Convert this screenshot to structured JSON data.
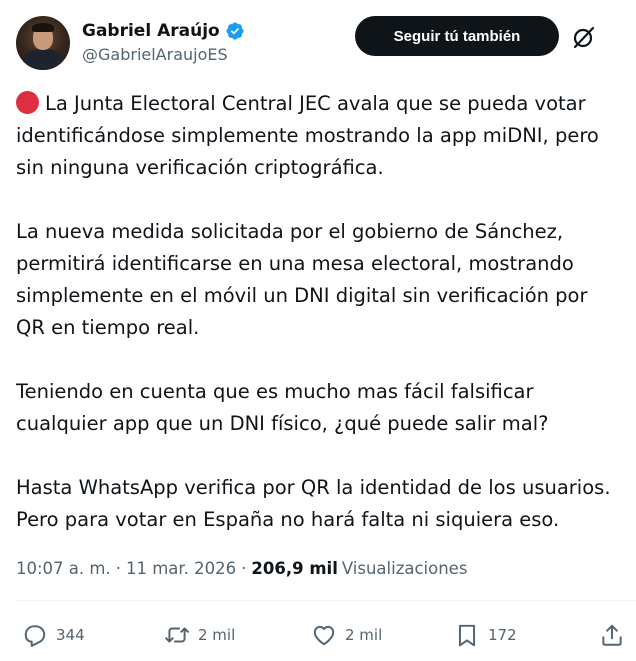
{
  "author": {
    "display_name": "Gabriel Araújo",
    "handle": "@GabrielAraujoES",
    "verified": true,
    "avatar_icon": "profile-photo"
  },
  "header": {
    "follow_label": "Seguir tú también",
    "grok_icon": "grok-icon"
  },
  "tweet": {
    "lines": [
      "La Junta Electoral Central JEC avala que se pueda votar",
      "identificándose simplemente mostrando la app miDNI, pero",
      "sin ninguna verificación criptográfica.",
      "La nueva medida solicitada por el gobierno de Sánchez,",
      "permitirá identificarse en una mesa electoral, mostrando",
      "simplemente en el móvil un DNI digital sin verificación por",
      "QR en tiempo real.",
      "Teniendo en cuenta que es mucho mas fácil falsificar",
      "cualquier app que un DNI físico, ¿qué puede salir mal?",
      "Hasta WhatsApp verifica por QR la identidad de los usuarios.",
      "Pero para votar en España no hará falta ni siquiera eso."
    ],
    "leading_emoji": "red-circle"
  },
  "meta": {
    "time": "10:07 a. m.",
    "separator": "·",
    "date": "11 mar. 2026",
    "views_count": "206,9 mil",
    "views_label": "Visualizaciones"
  },
  "actions": {
    "replies": "344",
    "reposts": "2 mil",
    "likes": "2 mil",
    "bookmarks": "172"
  },
  "colors": {
    "text": "#0f1419",
    "secondary": "#536471",
    "verified": "#1d9bf0",
    "red_circle": "#dd2e44",
    "follow_button_bg": "#0f1419"
  }
}
